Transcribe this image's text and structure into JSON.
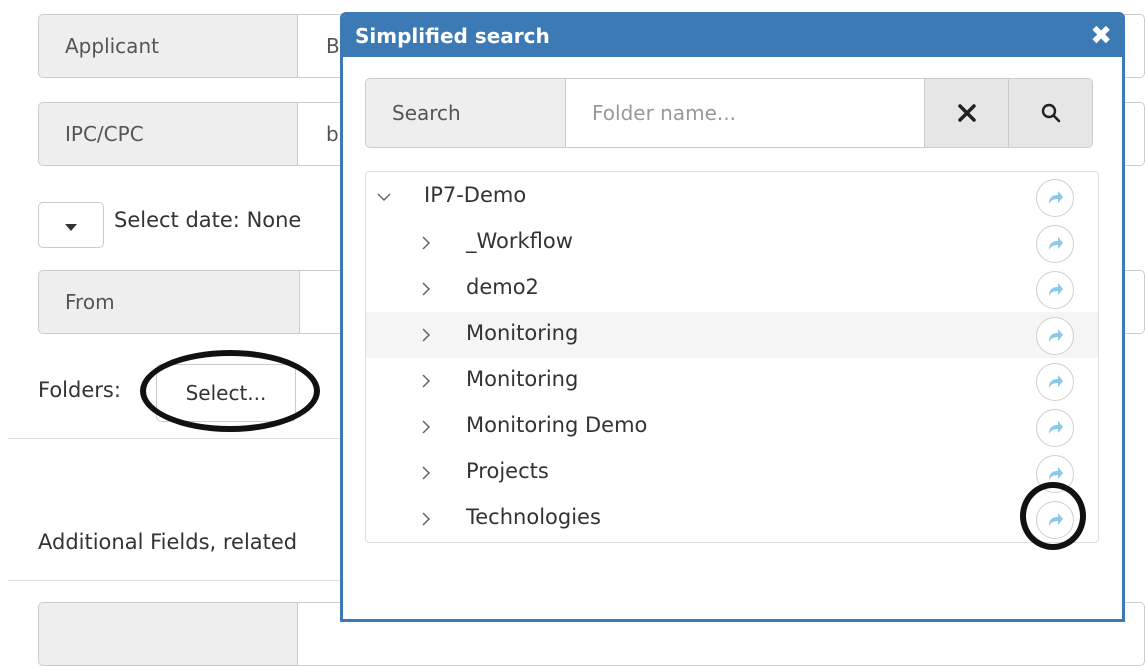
{
  "form": {
    "applicant_label": "Applicant",
    "applicant_value": "B",
    "ipc_label": "IPC/CPC",
    "ipc_value": "b",
    "date_label": "Select date:  None",
    "from_label": "From",
    "folders_label": "Folders:",
    "select_button": "Select...",
    "additional_fields": "Additional Fields, related"
  },
  "modal": {
    "title": "Simplified search",
    "close_icon": "close-icon",
    "search_label": "Search",
    "search_placeholder": "Folder name...",
    "clear_icon": "clear-icon",
    "search_icon": "search-icon"
  },
  "tree": {
    "root": {
      "label": "IP7-Demo",
      "expanded": true
    },
    "children": [
      {
        "label": "_Workflow"
      },
      {
        "label": "demo2"
      },
      {
        "label": "Monitoring"
      },
      {
        "label": "Monitoring"
      },
      {
        "label": "Monitoring Demo"
      },
      {
        "label": "Projects"
      },
      {
        "label": "Technologies"
      }
    ]
  },
  "colors": {
    "modal_header": "#3c7ab5",
    "share_icon": "#8cc8e8"
  }
}
